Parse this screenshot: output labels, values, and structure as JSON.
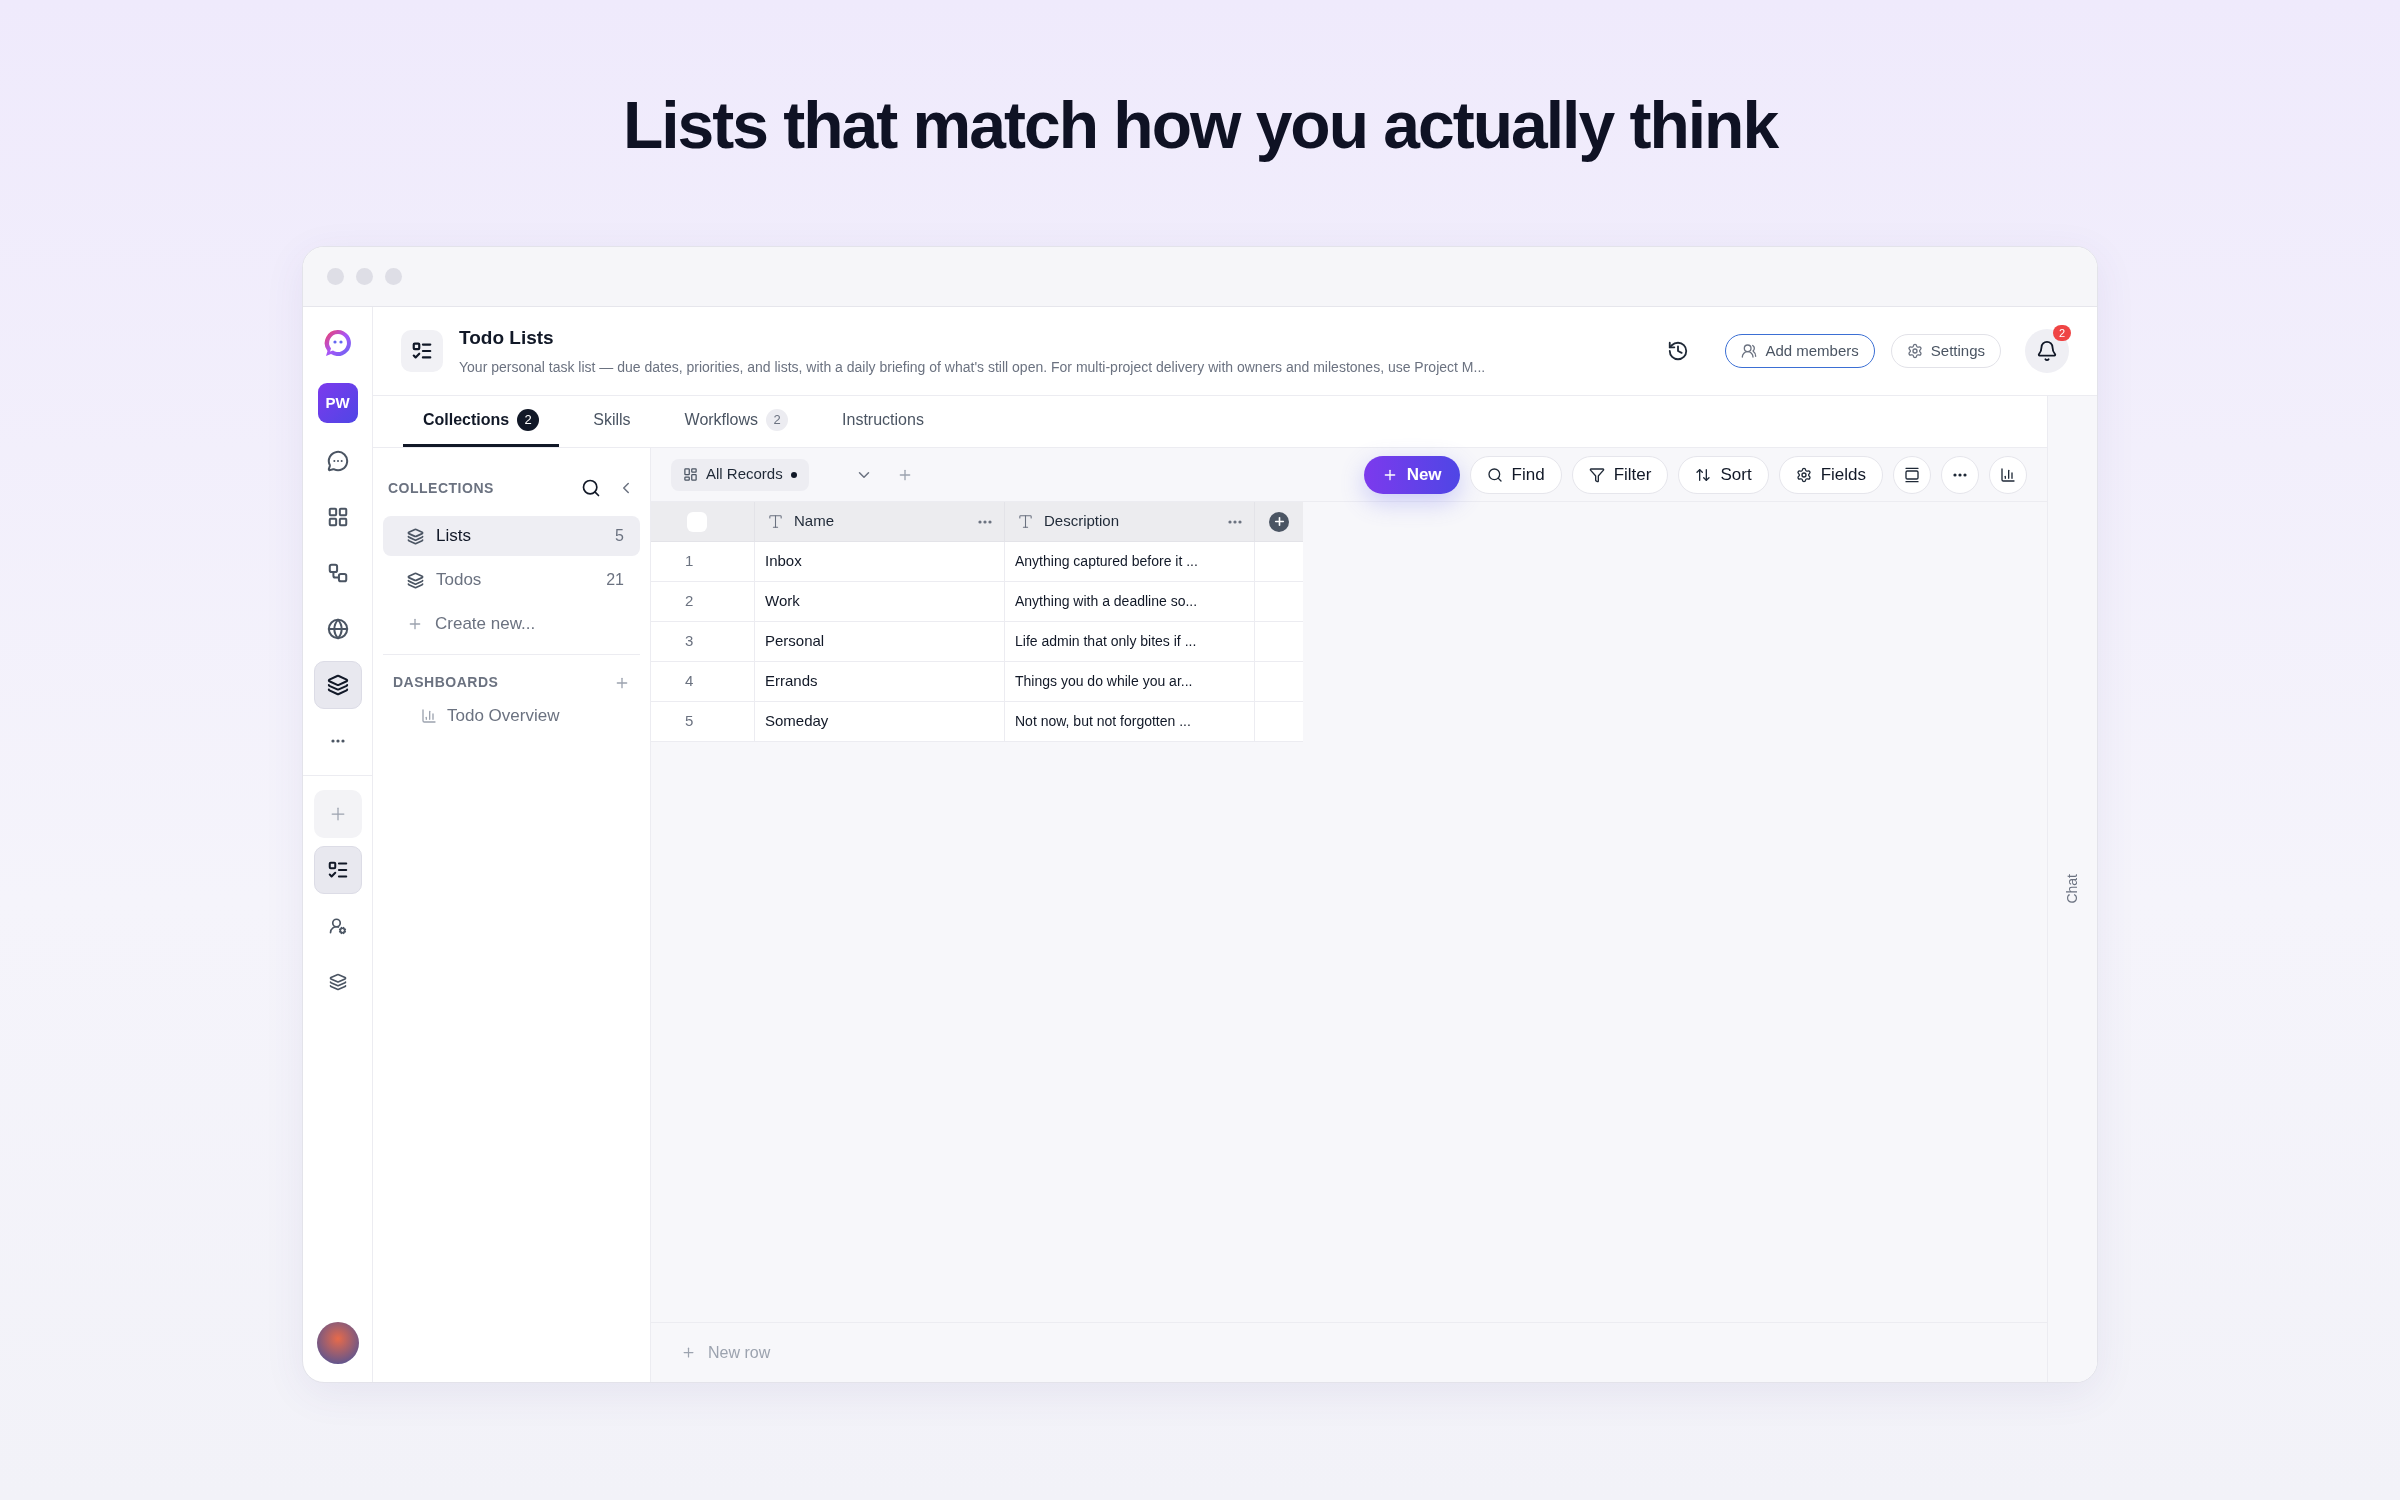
{
  "headline": "Lists that match how you actually think",
  "rail": {
    "initials": "PW",
    "top_items": [
      {
        "kind": "chat",
        "selected": false
      },
      {
        "kind": "apps",
        "selected": false
      },
      {
        "kind": "flow",
        "selected": false
      },
      {
        "kind": "globe",
        "selected": false
      },
      {
        "kind": "layers",
        "selected": true
      },
      {
        "kind": "more",
        "selected": false
      }
    ],
    "bottom_items": [
      {
        "kind": "add",
        "selected": false
      },
      {
        "kind": "todo",
        "selected": true
      },
      {
        "kind": "user",
        "selected": false
      },
      {
        "kind": "layers-small",
        "selected": false
      }
    ]
  },
  "header": {
    "title": "Todo Lists",
    "description": "Your personal task list — due dates, priorities, and lists, with a daily briefing of what's still open. For multi-project delivery with owners and milestones, use Project M...",
    "add_members": "Add members",
    "settings": "Settings",
    "notification_count": "2"
  },
  "tabs": [
    {
      "label": "Collections",
      "count": "2",
      "selected": true
    },
    {
      "label": "Skills",
      "selected": false
    },
    {
      "label": "Workflows",
      "count": "2",
      "selected": false
    },
    {
      "label": "Instructions",
      "selected": false
    }
  ],
  "collections_panel": {
    "heading": "COLLECTIONS",
    "items": [
      {
        "label": "Lists",
        "count": "5",
        "selected": true
      },
      {
        "label": "Todos",
        "count": "21",
        "selected": false
      }
    ],
    "create": "Create new...",
    "dashboards_heading": "DASHBOARDS",
    "dashboards": [
      {
        "label": "Todo Overview"
      }
    ]
  },
  "toolbar": {
    "view": "All Records",
    "buttons": [
      {
        "kind": "new",
        "label": "New"
      },
      {
        "kind": "find",
        "label": "Find"
      },
      {
        "kind": "filter",
        "label": "Filter"
      },
      {
        "kind": "sort",
        "label": "Sort"
      },
      {
        "kind": "fields",
        "label": "Fields"
      },
      {
        "kind": "row-height"
      },
      {
        "kind": "more"
      },
      {
        "kind": "chart"
      }
    ]
  },
  "table": {
    "select_all_checked": false,
    "columns": [
      "Name",
      "Description"
    ],
    "rows": [
      {
        "number": "1",
        "name": "Inbox",
        "description": "Anything captured before it ..."
      },
      {
        "number": "2",
        "name": "Work",
        "description": "Anything with a deadline so..."
      },
      {
        "number": "3",
        "name": "Personal",
        "description": "Life admin that only bites if ..."
      },
      {
        "number": "4",
        "name": "Errands",
        "description": "Things you do while you ar..."
      },
      {
        "number": "5",
        "name": "Someday",
        "description": "Not now, but not forgotten ..."
      }
    ]
  },
  "new_row": "New row",
  "chat_tab": "Chat"
}
